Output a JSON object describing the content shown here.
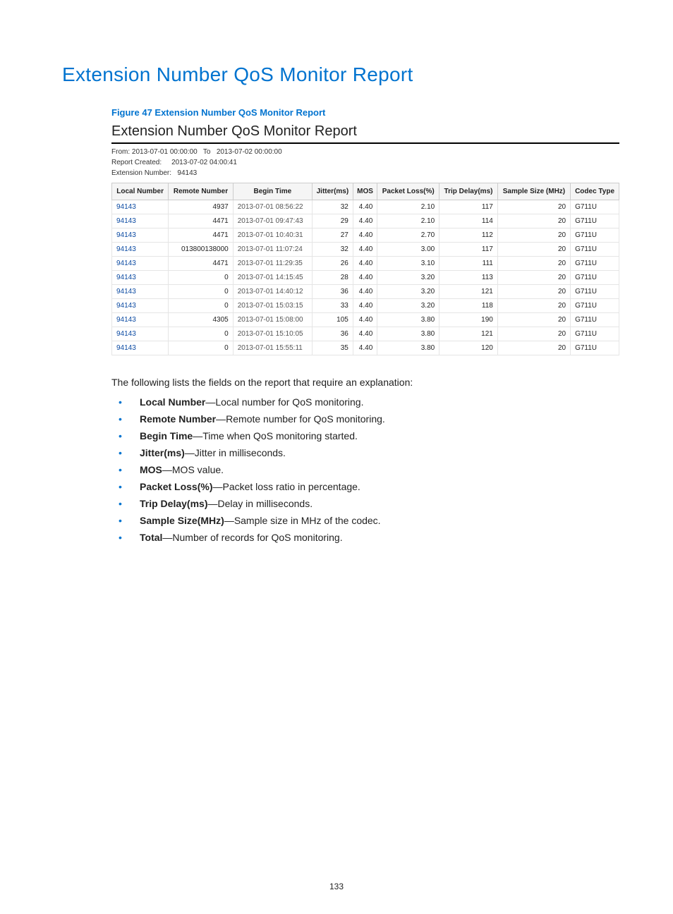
{
  "page_title": "Extension Number QoS Monitor Report",
  "figure_caption": "Figure 47 Extension Number QoS Monitor Report",
  "report_title": "Extension Number QoS Monitor Report",
  "meta": {
    "from_label": "From:",
    "from_value": "2013-07-01 00:00:00",
    "to_label": "To",
    "to_value": "2013-07-02 00:00:00",
    "created_label": "Report Created:",
    "created_value": "2013-07-02 04:00:41",
    "ext_label": "Extension Number:",
    "ext_value": "94143"
  },
  "columns": [
    "Local Number",
    "Remote Number",
    "Begin Time",
    "Jitter(ms)",
    "MOS",
    "Packet Loss(%)",
    "Trip Delay(ms)",
    "Sample Size (MHz)",
    "Codec Type"
  ],
  "rows": [
    {
      "local": "94143",
      "remote": "4937",
      "begin": "2013-07-01 08:56:22",
      "jitter": "32",
      "mos": "4.40",
      "loss": "2.10",
      "delay": "117",
      "sample": "20",
      "codec": "G711U"
    },
    {
      "local": "94143",
      "remote": "4471",
      "begin": "2013-07-01 09:47:43",
      "jitter": "29",
      "mos": "4.40",
      "loss": "2.10",
      "delay": "114",
      "sample": "20",
      "codec": "G711U"
    },
    {
      "local": "94143",
      "remote": "4471",
      "begin": "2013-07-01 10:40:31",
      "jitter": "27",
      "mos": "4.40",
      "loss": "2.70",
      "delay": "112",
      "sample": "20",
      "codec": "G711U"
    },
    {
      "local": "94143",
      "remote": "013800138000",
      "begin": "2013-07-01 11:07:24",
      "jitter": "32",
      "mos": "4.40",
      "loss": "3.00",
      "delay": "117",
      "sample": "20",
      "codec": "G711U"
    },
    {
      "local": "94143",
      "remote": "4471",
      "begin": "2013-07-01 11:29:35",
      "jitter": "26",
      "mos": "4.40",
      "loss": "3.10",
      "delay": "111",
      "sample": "20",
      "codec": "G711U"
    },
    {
      "local": "94143",
      "remote": "0",
      "begin": "2013-07-01 14:15:45",
      "jitter": "28",
      "mos": "4.40",
      "loss": "3.20",
      "delay": "113",
      "sample": "20",
      "codec": "G711U"
    },
    {
      "local": "94143",
      "remote": "0",
      "begin": "2013-07-01 14:40:12",
      "jitter": "36",
      "mos": "4.40",
      "loss": "3.20",
      "delay": "121",
      "sample": "20",
      "codec": "G711U"
    },
    {
      "local": "94143",
      "remote": "0",
      "begin": "2013-07-01 15:03:15",
      "jitter": "33",
      "mos": "4.40",
      "loss": "3.20",
      "delay": "118",
      "sample": "20",
      "codec": "G711U"
    },
    {
      "local": "94143",
      "remote": "4305",
      "begin": "2013-07-01 15:08:00",
      "jitter": "105",
      "mos": "4.40",
      "loss": "3.80",
      "delay": "190",
      "sample": "20",
      "codec": "G711U"
    },
    {
      "local": "94143",
      "remote": "0",
      "begin": "2013-07-01 15:10:05",
      "jitter": "36",
      "mos": "4.40",
      "loss": "3.80",
      "delay": "121",
      "sample": "20",
      "codec": "G711U"
    },
    {
      "local": "94143",
      "remote": "0",
      "begin": "2013-07-01 15:55:11",
      "jitter": "35",
      "mos": "4.40",
      "loss": "3.80",
      "delay": "120",
      "sample": "20",
      "codec": "G711U"
    }
  ],
  "intro_text": "The following lists the fields on the report that require an explanation:",
  "field_defs": [
    {
      "name": "Local Number",
      "desc": "—Local number for QoS monitoring."
    },
    {
      "name": "Remote Number",
      "desc": "—Remote number for QoS monitoring."
    },
    {
      "name": "Begin Time",
      "desc": "—Time when QoS monitoring started."
    },
    {
      "name": "Jitter(ms)",
      "desc": "—Jitter in milliseconds."
    },
    {
      "name": "MOS",
      "desc": "—MOS value."
    },
    {
      "name": "Packet Loss(%)",
      "desc": "—Packet loss ratio in percentage."
    },
    {
      "name": "Trip Delay(ms)",
      "desc": "—Delay in milliseconds."
    },
    {
      "name": "Sample Size(MHz)",
      "desc": "—Sample size in MHz of the codec."
    },
    {
      "name": "Total",
      "desc": "—Number of records for QoS monitoring."
    }
  ],
  "page_number": "133",
  "chart_data": {
    "type": "table",
    "title": "Extension Number QoS Monitor Report",
    "columns": [
      "Local Number",
      "Remote Number",
      "Begin Time",
      "Jitter(ms)",
      "MOS",
      "Packet Loss(%)",
      "Trip Delay(ms)",
      "Sample Size (MHz)",
      "Codec Type"
    ],
    "rows": [
      [
        "94143",
        "4937",
        "2013-07-01 08:56:22",
        32,
        4.4,
        2.1,
        117,
        20,
        "G711U"
      ],
      [
        "94143",
        "4471",
        "2013-07-01 09:47:43",
        29,
        4.4,
        2.1,
        114,
        20,
        "G711U"
      ],
      [
        "94143",
        "4471",
        "2013-07-01 10:40:31",
        27,
        4.4,
        2.7,
        112,
        20,
        "G711U"
      ],
      [
        "94143",
        "013800138000",
        "2013-07-01 11:07:24",
        32,
        4.4,
        3.0,
        117,
        20,
        "G711U"
      ],
      [
        "94143",
        "4471",
        "2013-07-01 11:29:35",
        26,
        4.4,
        3.1,
        111,
        20,
        "G711U"
      ],
      [
        "94143",
        "0",
        "2013-07-01 14:15:45",
        28,
        4.4,
        3.2,
        113,
        20,
        "G711U"
      ],
      [
        "94143",
        "0",
        "2013-07-01 14:40:12",
        36,
        4.4,
        3.2,
        121,
        20,
        "G711U"
      ],
      [
        "94143",
        "0",
        "2013-07-01 15:03:15",
        33,
        4.4,
        3.2,
        118,
        20,
        "G711U"
      ],
      [
        "94143",
        "4305",
        "2013-07-01 15:08:00",
        105,
        4.4,
        3.8,
        190,
        20,
        "G711U"
      ],
      [
        "94143",
        "0",
        "2013-07-01 15:10:05",
        36,
        4.4,
        3.8,
        121,
        20,
        "G711U"
      ],
      [
        "94143",
        "0",
        "2013-07-01 15:55:11",
        35,
        4.4,
        3.8,
        120,
        20,
        "G711U"
      ]
    ]
  }
}
